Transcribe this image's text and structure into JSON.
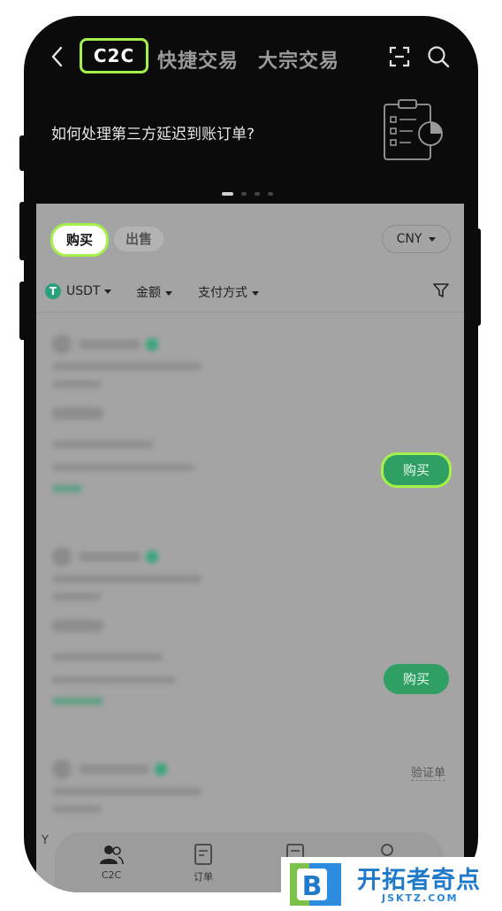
{
  "header": {
    "back_icon": "chevron-left-icon",
    "tabs": [
      {
        "label": "C2C",
        "active": true
      },
      {
        "label": "快捷交易",
        "active": false
      },
      {
        "label": "大宗交易",
        "active": false
      }
    ],
    "scan_icon": "scan-icon",
    "search_icon": "search-icon"
  },
  "banner": {
    "text": "如何处理第三方延迟到账订单?",
    "illustration_icon": "clipboard-chart-icon",
    "dots_total": 4,
    "dots_active": 1
  },
  "trade": {
    "buy_label": "购买",
    "sell_label": "出售",
    "currency": "CNY"
  },
  "filters": {
    "coin": "USDT",
    "amount": "金额",
    "payment": "支付方式",
    "filter_icon": "funnel-icon"
  },
  "ads": [
    {
      "button": "购买",
      "highlighted": true
    },
    {
      "button": "购买",
      "highlighted": false
    },
    {
      "extra_link": "验证单"
    }
  ],
  "bottom_nav": {
    "items": [
      {
        "label": "C2C",
        "icon": "users-icon"
      },
      {
        "label": "订单",
        "icon": "document-icon"
      },
      {
        "label": "",
        "icon": "document-icon"
      },
      {
        "label": "",
        "icon": "user-icon"
      }
    ]
  },
  "partial_char": "Y",
  "watermark": {
    "brand": "开拓者奇点",
    "domain": "JSKTZ.COM",
    "logo_letter": "B"
  },
  "colors": {
    "highlight": "#a6f04a",
    "buy_green": "#2f9f63",
    "tether": "#26a17b",
    "watermark_blue": "#1f7ac9"
  }
}
